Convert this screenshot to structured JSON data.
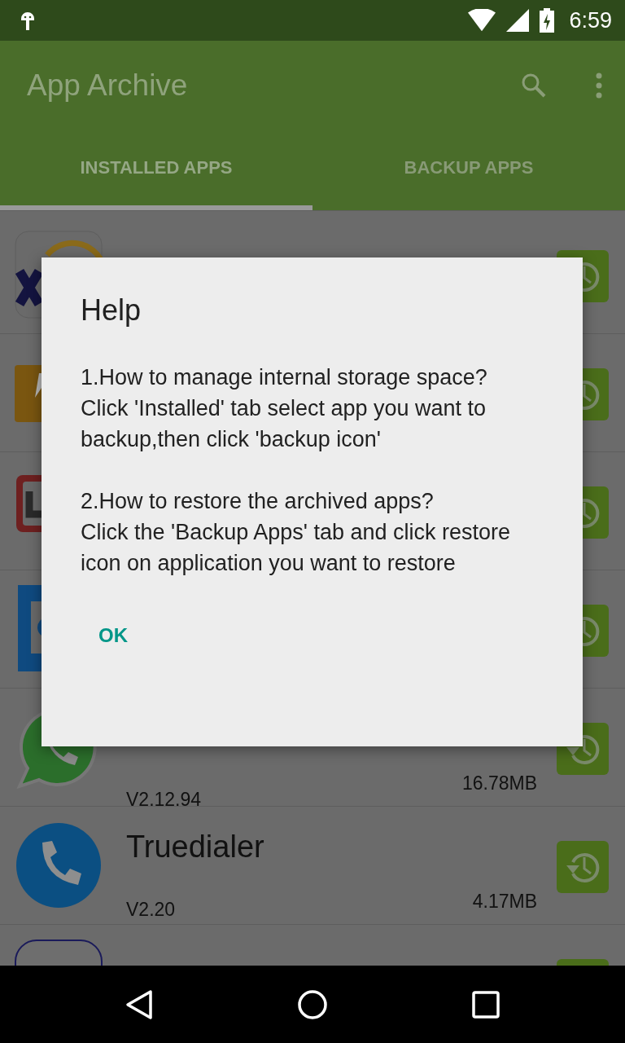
{
  "status_bar": {
    "time": "6:59"
  },
  "app_bar": {
    "title": "App Archive"
  },
  "tabs": [
    {
      "label": "INSTALLED APPS",
      "selected": true
    },
    {
      "label": "BACKUP APPS",
      "selected": false
    }
  ],
  "rows": [
    {},
    {},
    {},
    {},
    {
      "version": "V2.12.94",
      "size": "16.78MB"
    },
    {
      "name": "Truedialer",
      "version": "V2.20",
      "size": "4.17MB"
    },
    {}
  ],
  "dialog": {
    "title": "Help",
    "message": "1.How to manage internal storage space?\nClick 'Installed' tab select app you want to backup,then click 'backup icon'\n\n2.How to restore the archived apps?\nClick the 'Backup Apps' tab and click restore icon on application you want to restore",
    "button": "OK"
  }
}
